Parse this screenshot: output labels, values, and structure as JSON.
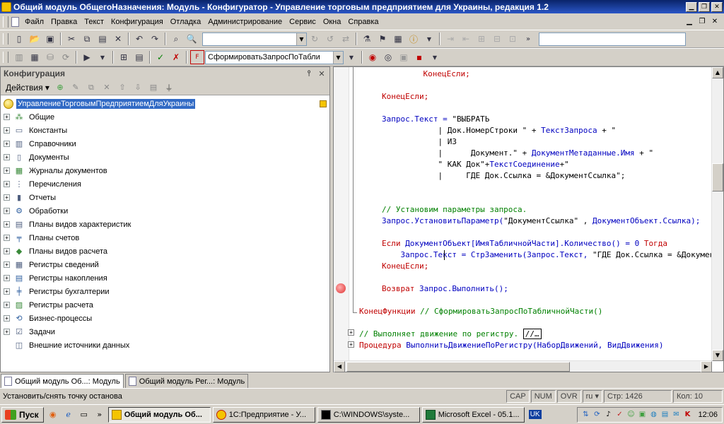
{
  "window": {
    "title": "Общий модуль ОбщегоНазначения: Модуль - Конфигуратор - Управление торговым предприятием для Украины, редакция 1.2"
  },
  "menu": [
    "Файл",
    "Правка",
    "Текст",
    "Конфигурация",
    "Отладка",
    "Администрирование",
    "Сервис",
    "Окна",
    "Справка"
  ],
  "toolbar2": {
    "procedure_combo": "СформироватьЗапросПоТабли"
  },
  "config_panel": {
    "title": "Конфигурация",
    "actions_label": "Действия",
    "root": "УправлениеТорговымПредприятиемДляУкраины",
    "items": [
      {
        "label": "Общие",
        "icon": "common-icon"
      },
      {
        "label": "Константы",
        "icon": "constants-icon"
      },
      {
        "label": "Справочники",
        "icon": "catalogs-icon"
      },
      {
        "label": "Документы",
        "icon": "documents-icon"
      },
      {
        "label": "Журналы документов",
        "icon": "journals-icon"
      },
      {
        "label": "Перечисления",
        "icon": "enums-icon"
      },
      {
        "label": "Отчеты",
        "icon": "reports-icon"
      },
      {
        "label": "Обработки",
        "icon": "processing-icon"
      },
      {
        "label": "Планы видов характеристик",
        "icon": "char-plans-icon"
      },
      {
        "label": "Планы счетов",
        "icon": "accounts-plans-icon"
      },
      {
        "label": "Планы видов расчета",
        "icon": "calc-plans-icon"
      },
      {
        "label": "Регистры сведений",
        "icon": "info-registers-icon"
      },
      {
        "label": "Регистры накопления",
        "icon": "accum-registers-icon"
      },
      {
        "label": "Регистры бухгалтерии",
        "icon": "accounting-registers-icon"
      },
      {
        "label": "Регистры расчета",
        "icon": "calc-registers-icon"
      },
      {
        "label": "Бизнес-процессы",
        "icon": "business-process-icon"
      },
      {
        "label": "Задачи",
        "icon": "tasks-icon"
      },
      {
        "label": "Внешние источники данных",
        "icon": "external-sources-icon"
      }
    ]
  },
  "code": {
    "l1": "    КонецЕсли;",
    "l2": "КонецЕсли;",
    "l3a": "Запрос.Текст = ",
    "l3b": "\"ВЫБРАТЬ",
    "l4a": "            | Док.НомерСтроки \" + ",
    "l4b": "ТекстЗапроса",
    "l4c": " + \"",
    "l5": "            | ИЗ",
    "l6a": "            |      Документ.\" + ",
    "l6b": "ДокументМетаданные.Имя",
    "l6c": " + \"",
    "l7a": "            \" КАК Док\"+",
    "l7b": "ТекстСоединение",
    "l7c": "+\"",
    "l8": "            |     ГДЕ Док.Ссылка = &ДокументСсылка\";",
    "l9": "// Установим параметры запроса.",
    "l10a": "Запрос.УстановитьПараметр(",
    "l10b": "\"ДокументСсылка\" , ",
    "l10c": "ДокументОбъект.Ссылка);",
    "l11a": "Если ",
    "l11b": "ДокументОбъект[ИмяТабличнойЧасти].Количество() = 0 ",
    "l11c": "Тогда",
    "l12a": "    Запрос.Текст = СтрЗаменить(Запрос.Текст, ",
    "l12b": "\"ГДЕ Док.Ссылка = &ДокументСсылка\", \"\");",
    "l13": "КонецЕсли;",
    "l14a": "Возврат ",
    "l14b": "Запрос.Выполнить();",
    "l15a": "КонецФункции ",
    "l15b": "// СформироватьЗапросПоТабличнойЧасти()",
    "l16a": "// Выполняет движение по регистру. ",
    "l16b": "//…",
    "l17a": "Процедура ",
    "l17b": "ВыполнитьДвижениеПоРегистру(НаборДвижений, ВидДвижения)"
  },
  "tabs": [
    "Общий модуль Об...: Модуль",
    "Общий модуль Рег...: Модуль"
  ],
  "status": {
    "text": "Установить/снять точку останова",
    "cap": "CAP",
    "num": "NUM",
    "ovr": "OVR",
    "lang": "ru",
    "line": "Стр: 1426",
    "col": "Кол: 10"
  },
  "taskbar": {
    "start": "Пуск",
    "buttons": [
      "Общий модуль Об...",
      "1С:Предприятие - У...",
      "C:\\WINDOWS\\syste...",
      "Microsoft Excel - 05.1..."
    ],
    "lang": "UK",
    "time": "12:06"
  },
  "colors": {
    "title_bar": "#0a246a",
    "keyword": "#c00000",
    "identifier": "#0000c0",
    "comment": "#008000",
    "selection": "#316ac5"
  }
}
